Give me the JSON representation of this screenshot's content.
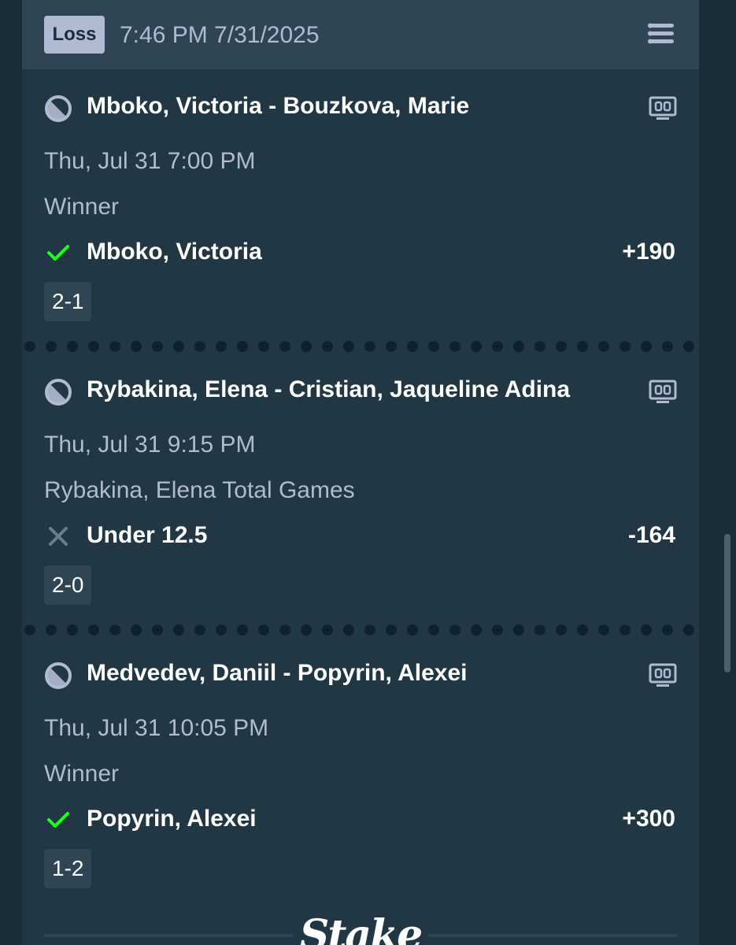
{
  "header": {
    "status": "Loss",
    "timestamp": "7:46 PM 7/31/2025",
    "menu_icon": "menu-icon"
  },
  "legs": [
    {
      "sport_icon": "tennis-ball-icon",
      "event": "Mboko, Victoria - Bouzkova, Marie",
      "stream_icon": "live-stream-icon",
      "date": "Thu, Jul 31 7:00 PM",
      "market": "Winner",
      "outcome": "won",
      "outcome_icon": "check-icon",
      "selection": "Mboko, Victoria",
      "odds": "+190",
      "score": "2-1"
    },
    {
      "sport_icon": "tennis-ball-icon",
      "event": "Rybakina, Elena - Cristian, Jaqueline Adina",
      "stream_icon": "live-stream-icon",
      "date": "Thu, Jul 31 9:15 PM",
      "market": "Rybakina, Elena Total Games",
      "outcome": "lost",
      "outcome_icon": "cross-icon",
      "selection": "Under 12.5",
      "odds": "-164",
      "score": "2-0"
    },
    {
      "sport_icon": "tennis-ball-icon",
      "event": "Medvedev, Daniil - Popyrin, Alexei",
      "stream_icon": "live-stream-icon",
      "date": "Thu, Jul 31 10:05 PM",
      "market": "Winner",
      "outcome": "won",
      "outcome_icon": "check-icon",
      "selection": "Popyrin, Alexei",
      "odds": "+300",
      "score": "1-2"
    }
  ],
  "footer": {
    "brand": "Stake"
  },
  "colors": {
    "page_bg": "#1a2c38",
    "card_bg": "#213743",
    "header_bg": "#2f4553",
    "muted_text": "#b1bad3",
    "win_green": "#1fff20",
    "loss_grey": "#6b7d8a"
  }
}
